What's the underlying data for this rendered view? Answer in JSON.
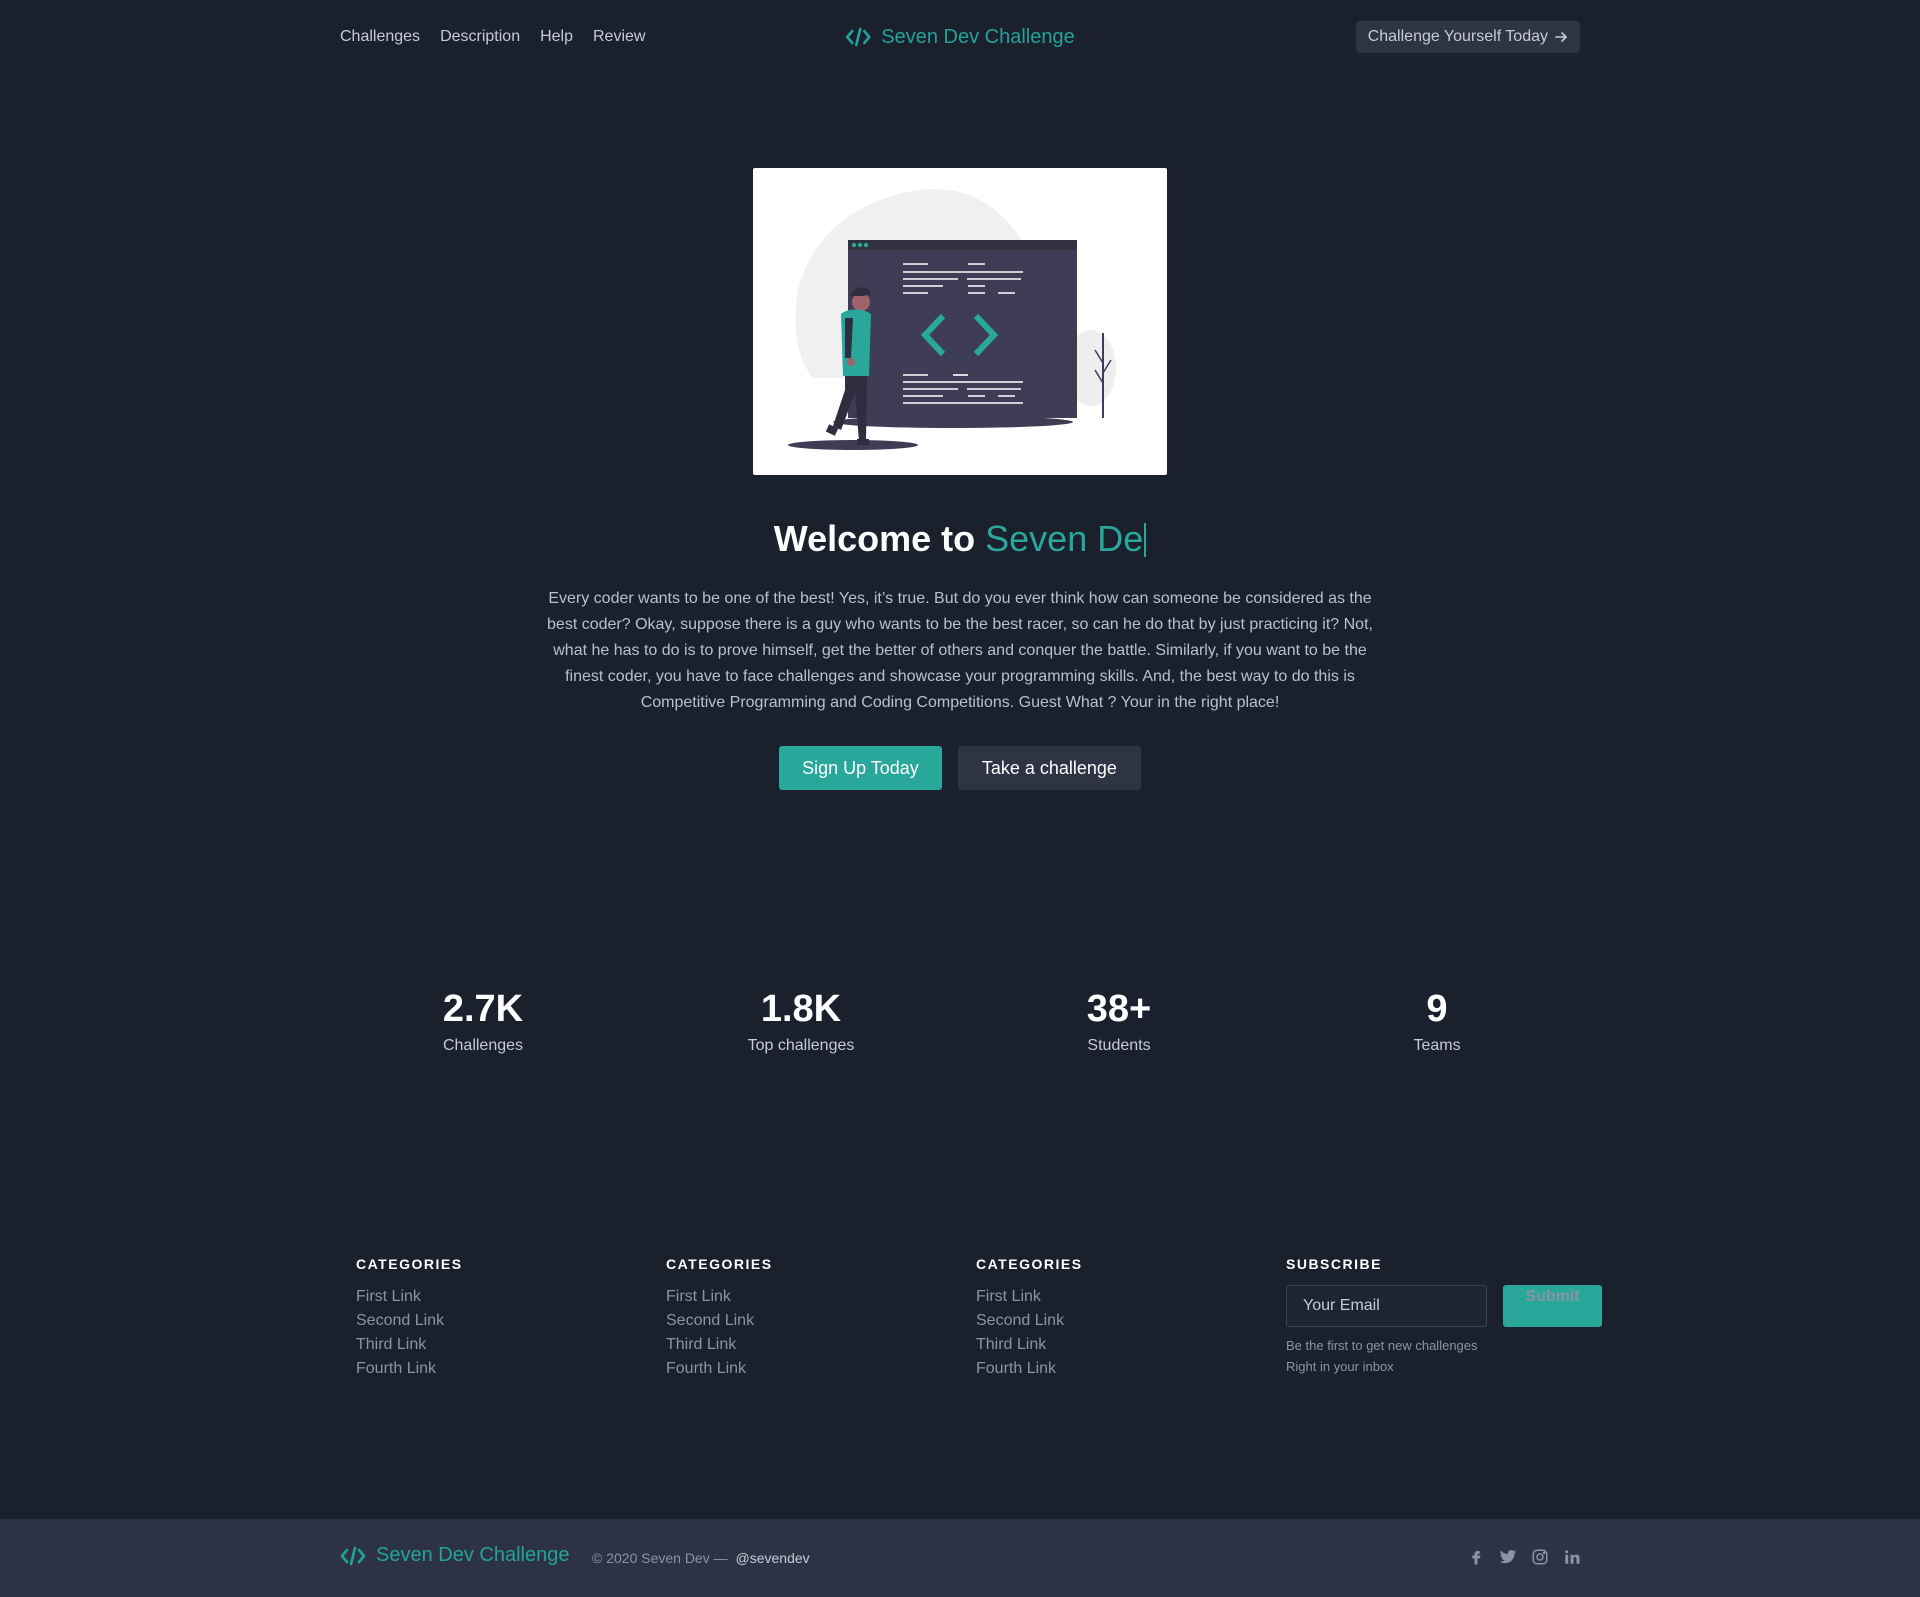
{
  "header": {
    "nav": [
      "Challenges",
      "Description",
      "Help",
      "Review"
    ],
    "brand": "Seven Dev Challenge",
    "cta": "Challenge Yourself Today"
  },
  "hero": {
    "title_prefix": "Welcome to",
    "title_accent": "Seven De",
    "text": "Every coder wants to be one of the best! Yes, it’s true. But do you ever think how can someone be considered as the best coder? Okay, suppose there is a guy who wants to be the best racer, so can he do that by just practicing it? Not, what he has to do is to prove himself, get the better of others and conquer the battle. Similarly, if you want to be the finest coder, you have to face challenges and showcase your programming skills. And, the best way to do this is Competitive Programming and Coding Competitions. Guest What ? Your in the right place!",
    "primary_button": "Sign Up Today",
    "secondary_button": "Take a challenge"
  },
  "stats": [
    {
      "value": "2.7K",
      "label": "Challenges"
    },
    {
      "value": "1.8K",
      "label": "Top challenges"
    },
    {
      "value": "38+",
      "label": "Students"
    },
    {
      "value": "9",
      "label": "Teams"
    }
  ],
  "footer": {
    "columns": [
      {
        "title": "CATEGORIES",
        "links": [
          "First Link",
          "Second Link",
          "Third Link",
          "Fourth Link"
        ]
      },
      {
        "title": "CATEGORIES",
        "links": [
          "First Link",
          "Second Link",
          "Third Link",
          "Fourth Link"
        ]
      },
      {
        "title": "CATEGORIES",
        "links": [
          "First Link",
          "Second Link",
          "Third Link",
          "Fourth Link"
        ]
      }
    ],
    "subscribe": {
      "title": "SUBSCRIBE",
      "placeholder": "Your Email",
      "button": "Submit",
      "note_line1": "Be the first to get new challenges",
      "note_line2": "Right in your inbox"
    }
  },
  "bottom": {
    "brand": "Seven Dev Challenge",
    "copyright": "© 2020 Seven Dev —",
    "handle": "@sevendev",
    "socials": [
      "facebook-icon",
      "twitter-icon",
      "instagram-icon",
      "linkedin-icon"
    ]
  },
  "colors": {
    "background": "#1b202d",
    "accent": "#2aa79b",
    "surface": "#2f3445",
    "bottom_bar": "#2d3345"
  }
}
